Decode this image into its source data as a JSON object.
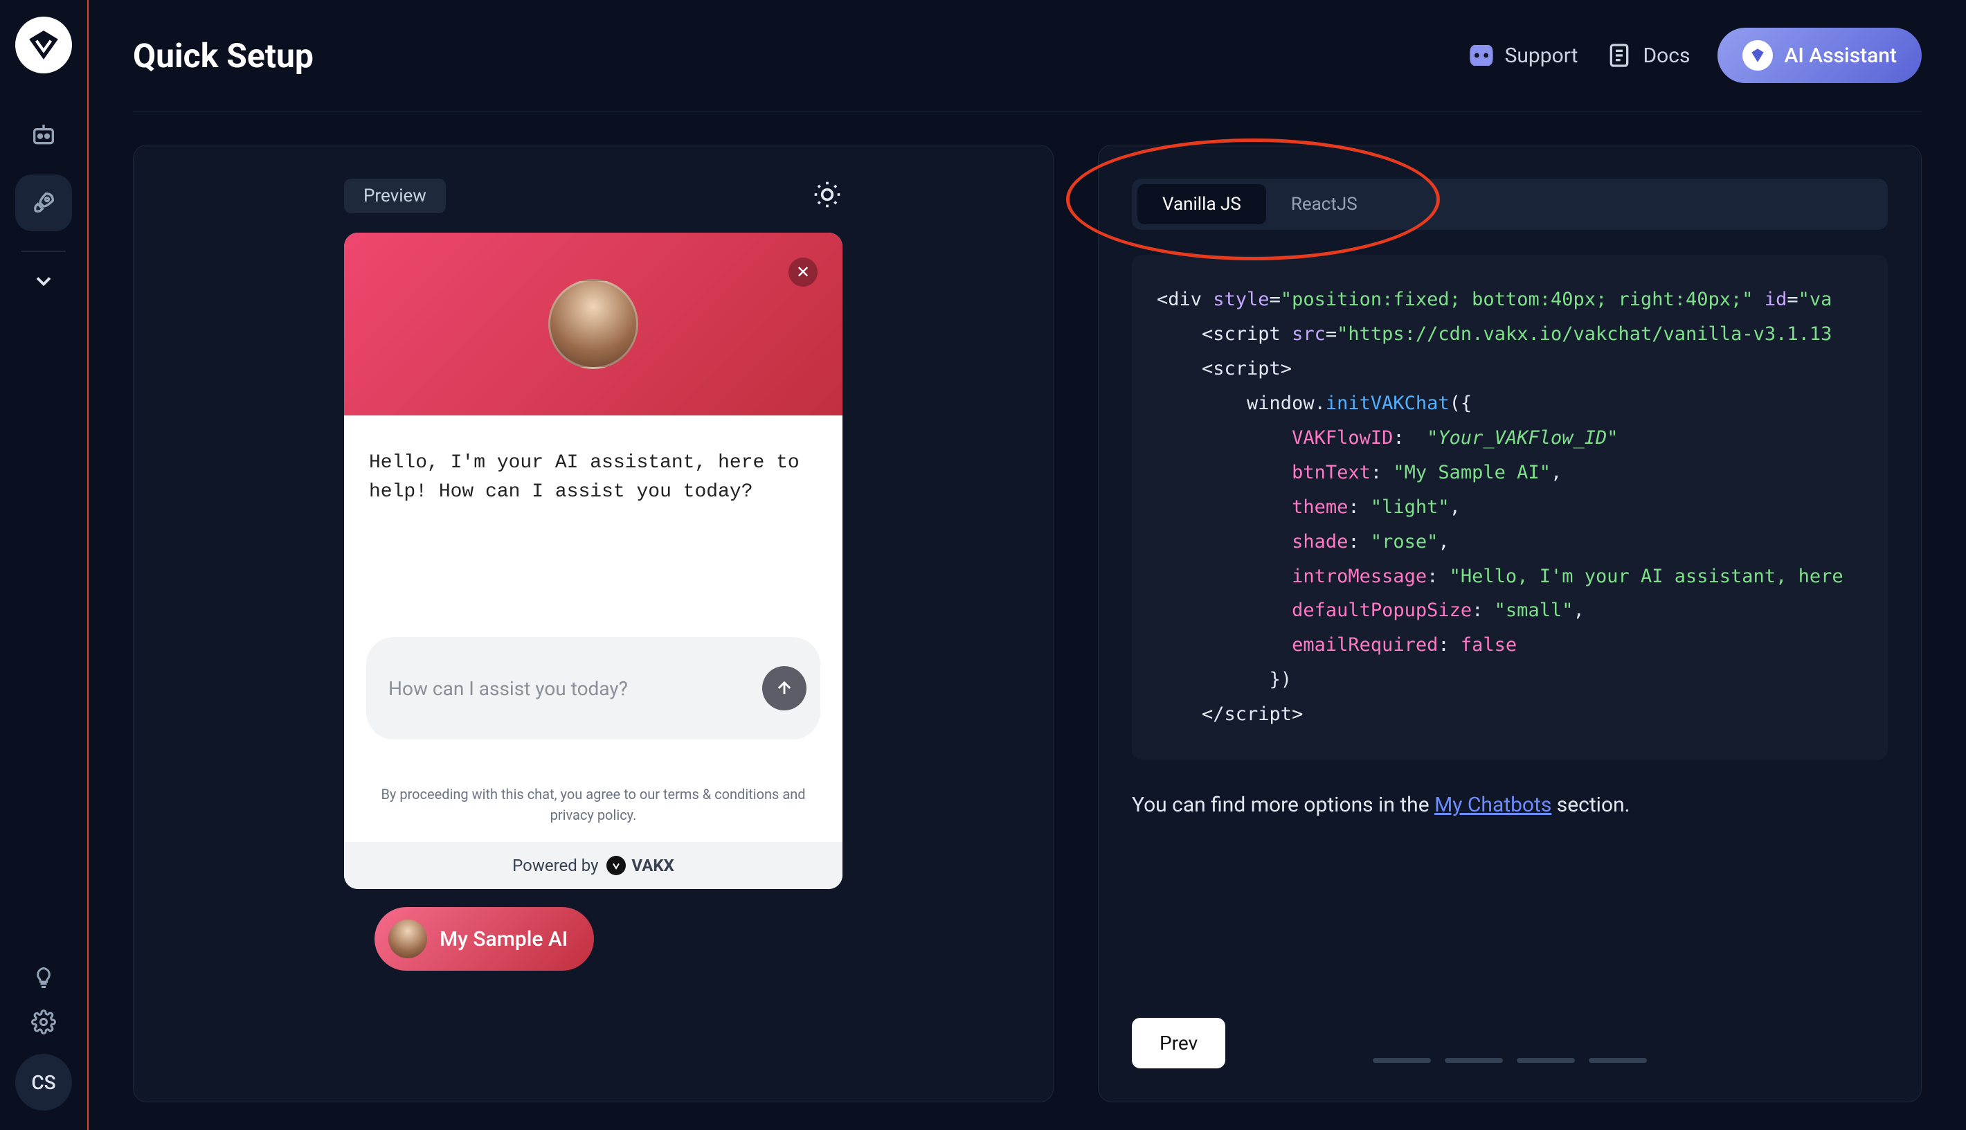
{
  "page": {
    "title": "Quick Setup"
  },
  "topbar": {
    "support": "Support",
    "docs": "Docs",
    "ai_assistant": "AI Assistant"
  },
  "sidebar": {
    "avatar_initials": "CS"
  },
  "preview": {
    "badge": "Preview",
    "intro_message": "Hello, I'm your AI assistant, here to help! How can I assist you today?",
    "input_placeholder": "How can I assist you today?",
    "terms": "By proceeding with this chat, you agree to our terms & conditions and privacy policy.",
    "powered_by": "Powered by",
    "brand": "VAKX",
    "launch_label": "My Sample AI"
  },
  "code_tabs": {
    "vanilla": "Vanilla JS",
    "react": "ReactJS"
  },
  "code": {
    "l1a": "<div ",
    "l1b": "style",
    "l1c": "=",
    "l1d": "\"position:fixed; bottom:40px; right:40px;\"",
    "l1e": " id",
    "l1f": "=",
    "l1g": "\"va",
    "l2a": "    <script ",
    "l2b": "src",
    "l2c": "=",
    "l2d": "\"https://cdn.vakx.io/vakchat/vanilla-v3.1.13",
    "l3": "    <script>",
    "l4a": "        window.",
    "l4b": "initVAKChat",
    "l4c": "({",
    "l5a": "            VAKFlowID",
    "l5b": ":  ",
    "l5c": "\"Your_VAKFlow_ID\"",
    "l6a": "            btnText",
    "l6b": ": ",
    "l6c": "\"My Sample AI\"",
    "l6d": ",",
    "l7a": "            theme",
    "l7b": ": ",
    "l7c": "\"light\"",
    "l7d": ",",
    "l8a": "            shade",
    "l8b": ": ",
    "l8c": "\"rose\"",
    "l8d": ",",
    "l9a": "            introMessage",
    "l9b": ": ",
    "l9c": "\"Hello, I'm your AI assistant, here",
    "l10a": "            defaultPopupSize",
    "l10b": ": ",
    "l10c": "\"small\"",
    "l10d": ",",
    "l11a": "            emailRequired",
    "l11b": ": ",
    "l11c": "false",
    "l12": "          })",
    "l13": "    </script>"
  },
  "info": {
    "prefix": "You can find more options in the ",
    "link": "My Chatbots",
    "suffix": " section."
  },
  "nav": {
    "prev": "Prev"
  }
}
